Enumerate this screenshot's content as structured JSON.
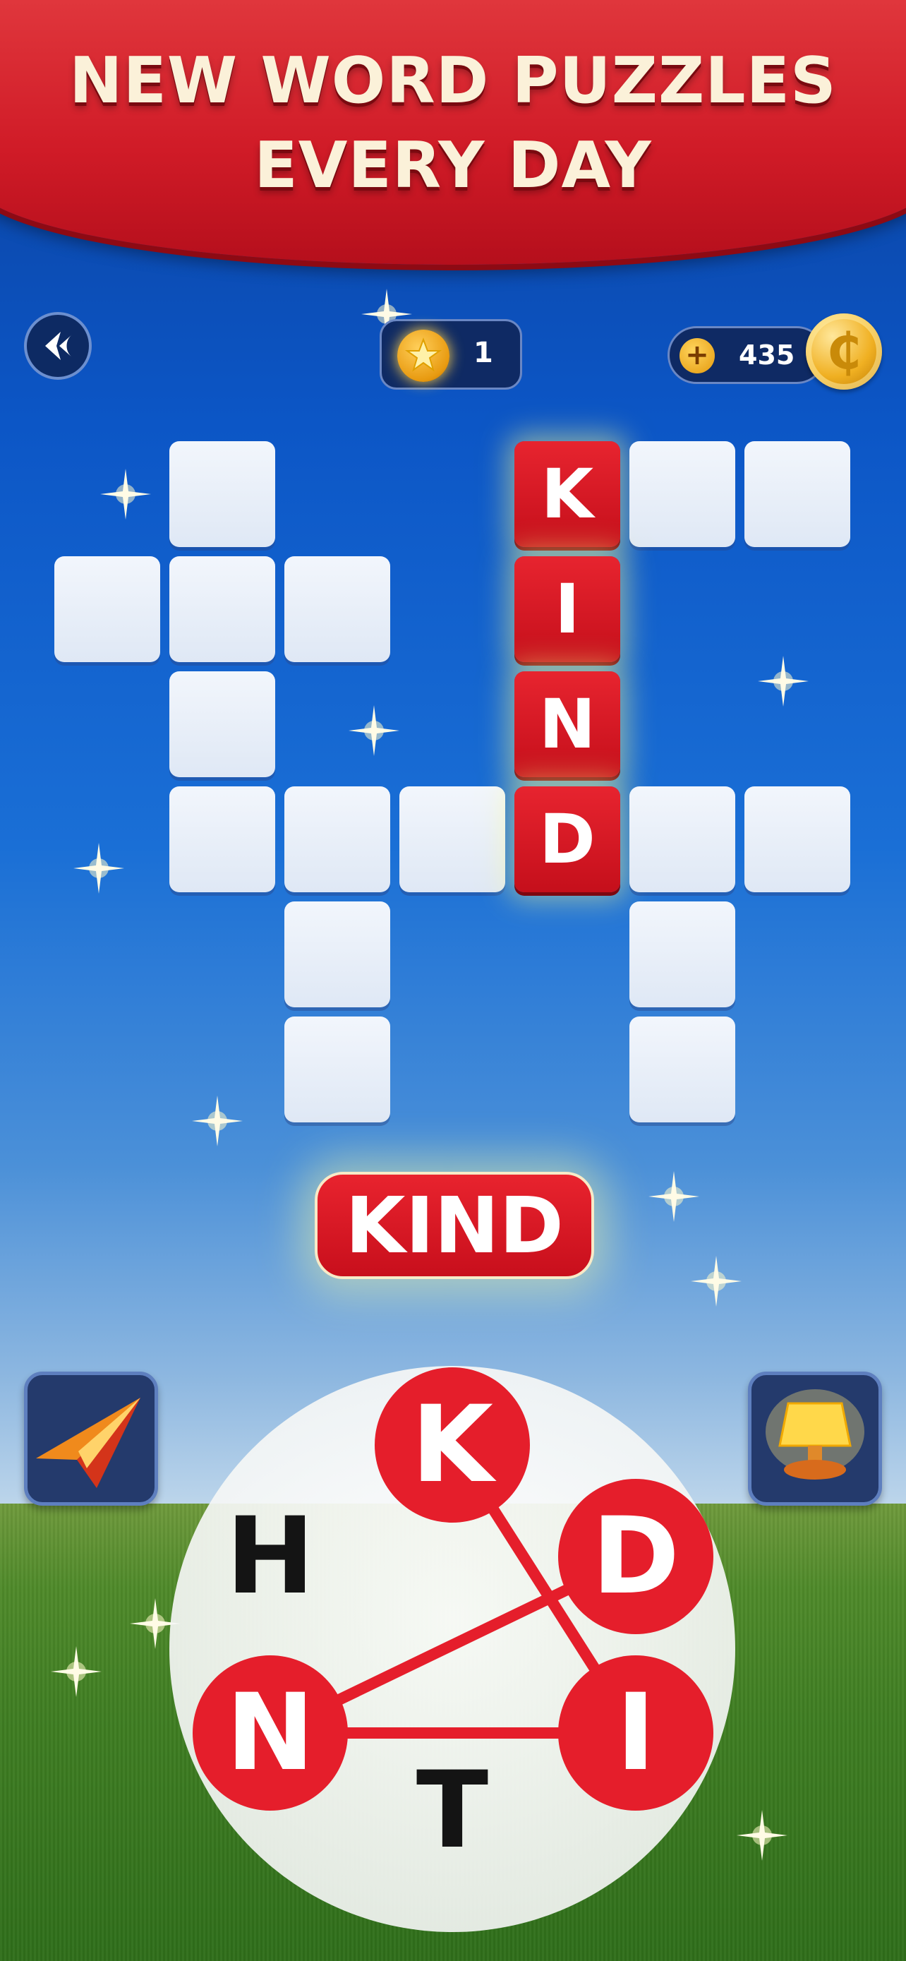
{
  "banner": {
    "line1": "NEW WORD PUZZLES",
    "line2": "EVERY DAY"
  },
  "header": {
    "back_icon": "back-arrow-icon",
    "stars_count": "1",
    "stars_icon": "star-coin-icon",
    "coins_plus_icon": "plus-icon",
    "coins_count": "435",
    "coin_icon": "coin-icon"
  },
  "crossword": {
    "grid_rows": 7,
    "grid_cols": 7,
    "found_word": "KIND",
    "cells": [
      {
        "row": 0,
        "col": 1,
        "letter": ""
      },
      {
        "row": 0,
        "col": 4,
        "letter": "K"
      },
      {
        "row": 0,
        "col": 5,
        "letter": ""
      },
      {
        "row": 0,
        "col": 6,
        "letter": ""
      },
      {
        "row": 1,
        "col": 0,
        "letter": ""
      },
      {
        "row": 1,
        "col": 1,
        "letter": ""
      },
      {
        "row": 1,
        "col": 2,
        "letter": ""
      },
      {
        "row": 1,
        "col": 4,
        "letter": "I"
      },
      {
        "row": 2,
        "col": 1,
        "letter": ""
      },
      {
        "row": 2,
        "col": 4,
        "letter": "N"
      },
      {
        "row": 3,
        "col": 1,
        "letter": ""
      },
      {
        "row": 3,
        "col": 2,
        "letter": ""
      },
      {
        "row": 3,
        "col": 3,
        "letter": ""
      },
      {
        "row": 3,
        "col": 4,
        "letter": "D"
      },
      {
        "row": 3,
        "col": 5,
        "letter": ""
      },
      {
        "row": 3,
        "col": 6,
        "letter": ""
      },
      {
        "row": 4,
        "col": 2,
        "letter": ""
      },
      {
        "row": 4,
        "col": 5,
        "letter": ""
      },
      {
        "row": 5,
        "col": 2,
        "letter": ""
      },
      {
        "row": 5,
        "col": 5,
        "letter": ""
      }
    ]
  },
  "current_word": "KIND",
  "tools": {
    "left_icon": "paper-plane-hint-icon",
    "right_icon": "lamp-hint-icon"
  },
  "wheel": {
    "letters": [
      {
        "letter": "K",
        "selected": true
      },
      {
        "letter": "D",
        "selected": true
      },
      {
        "letter": "I",
        "selected": true
      },
      {
        "letter": "T",
        "selected": false
      },
      {
        "letter": "N",
        "selected": true
      },
      {
        "letter": "H",
        "selected": false
      }
    ],
    "path_order": [
      "K",
      "I",
      "N",
      "D"
    ]
  },
  "colors": {
    "accent_red": "#e51e2b",
    "banner_text": "#fbf1d9",
    "tile_empty": "#eef3fb"
  }
}
